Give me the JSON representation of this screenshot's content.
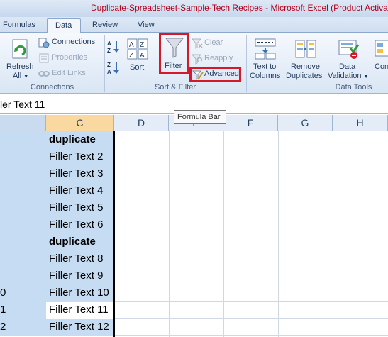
{
  "window": {
    "title": "Duplicate-Spreadsheet-Sample-Tech Recipes  -  Microsoft Excel (Product Activat"
  },
  "tabs": [
    {
      "label": "Formulas"
    },
    {
      "label": "Data"
    },
    {
      "label": "Review"
    },
    {
      "label": "View"
    }
  ],
  "ribbon": {
    "connections": {
      "refresh": {
        "line1": "Refresh",
        "line2": "All"
      },
      "connections_label": "Connections",
      "properties_label": "Properties",
      "edit_links_label": "Edit Links",
      "group_label": "Connections"
    },
    "sort_filter": {
      "sort_label": "Sort",
      "filter_label": "Filter",
      "clear_label": "Clear",
      "reapply_label": "Reapply",
      "advanced_label": "Advanced",
      "group_label": "Sort & Filter"
    },
    "data_tools": {
      "text_to_columns": {
        "line1": "Text to",
        "line2": "Columns"
      },
      "remove_duplicates": {
        "line1": "Remove",
        "line2": "Duplicates"
      },
      "data_validation": {
        "line1": "Data",
        "line2": "Validation"
      },
      "consolidate_partial": "Con",
      "group_label": "Data Tools"
    }
  },
  "formula_bar": {
    "content": "ler Text 11",
    "tooltip": "Formula Bar"
  },
  "grid": {
    "columns": [
      "C",
      "D",
      "E",
      "F",
      "G",
      "H"
    ],
    "row_number_fragments": [
      "",
      "",
      "",
      "",
      "",
      "",
      "",
      "",
      "",
      "0",
      "1",
      "2"
    ],
    "column_c": [
      "duplicate",
      "Filler Text 2",
      "Filler Text 3",
      "Filler Text 4",
      "Filler Text 5",
      "Filler Text 6",
      "duplicate",
      "Filler Text 8",
      "Filler Text 9",
      "Filler Text 10",
      "Filler Text 11",
      "Filler Text 12"
    ]
  },
  "colors": {
    "highlight": "#d4192a",
    "selection": "#c5dcf3",
    "header_selected": "#f9d99f"
  }
}
